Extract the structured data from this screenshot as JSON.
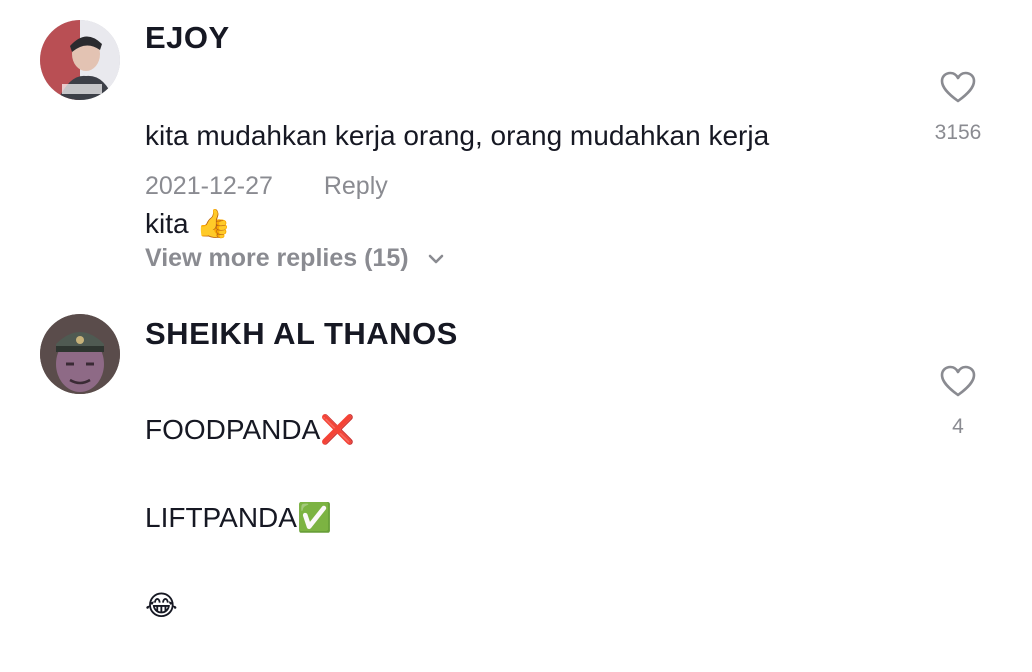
{
  "comments": [
    {
      "username": "EJOY",
      "lines": [
        "kita mudahkan kerja orang, orang mudahkan kerja",
        "kita 👍"
      ],
      "date": "2021-12-27",
      "reply_label": "Reply",
      "likes": "3156",
      "view_more_label": "View more replies (15)"
    },
    {
      "username": "SHEIKH AL THANOS",
      "lines": [
        "FOODPANDA❌",
        "LIFTPANDA✅",
        "😂"
      ],
      "likes": "4"
    }
  ]
}
